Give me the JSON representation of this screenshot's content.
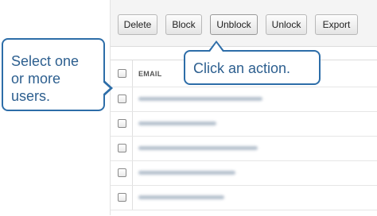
{
  "toolbar": {
    "buttons": [
      {
        "label": "Delete"
      },
      {
        "label": "Block"
      },
      {
        "label": "Unblock"
      },
      {
        "label": "Unlock"
      },
      {
        "label": "Export"
      }
    ]
  },
  "table": {
    "columns": [
      "EMAIL"
    ],
    "row_count": 6
  },
  "callouts": {
    "select_users": "Select one or more users.",
    "click_action": "Click an action."
  },
  "colors": {
    "callout_border": "#2d6da8",
    "callout_text": "#2d5f8f"
  }
}
